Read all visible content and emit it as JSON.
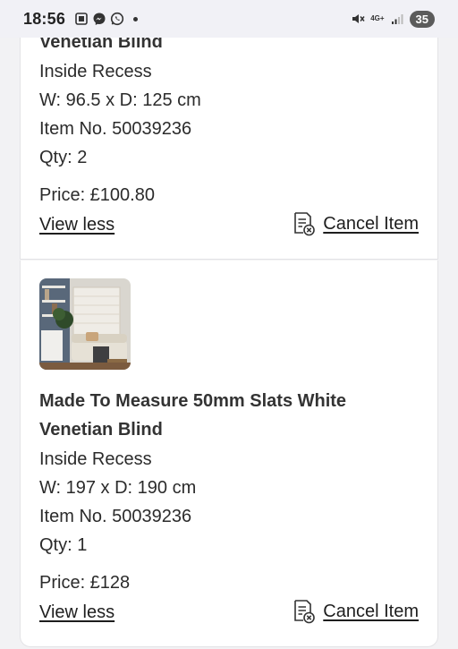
{
  "status_bar": {
    "time": "18:56",
    "network": "4G+",
    "battery": "35",
    "icons": [
      "screenshot-icon",
      "messenger-icon",
      "whatsapp-icon",
      "dot-icon",
      "mute-icon",
      "signal-icon"
    ]
  },
  "items": [
    {
      "title_line2": "Venetian Blind",
      "fitting": "Inside Recess",
      "size": "W: 96.5 x D: 125 cm",
      "item_no": "Item No. 50039236",
      "qty": "Qty: 2",
      "price": "Price: £100.80",
      "view_less": "View less",
      "cancel": "Cancel Item"
    },
    {
      "title_line1": "Made To Measure 50mm Slats White",
      "title_line2": "Venetian Blind",
      "fitting": "Inside Recess",
      "size": "W: 197 x D: 190 cm",
      "item_no": "Item No. 50039236",
      "qty": "Qty: 1",
      "price": "Price: £128",
      "view_less": "View less",
      "cancel": "Cancel Item"
    }
  ]
}
